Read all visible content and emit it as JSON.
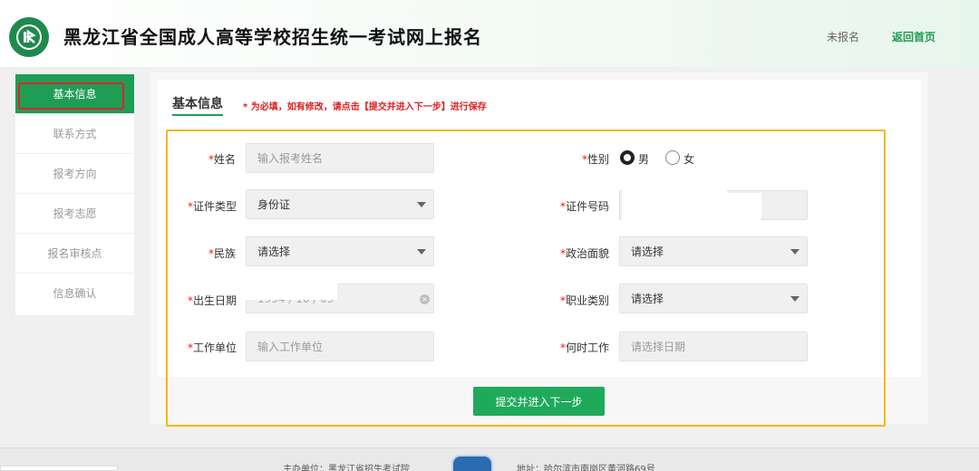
{
  "header": {
    "title": "黑龙江省全国成人高等学校招生统一考试网上报名",
    "status": "未报名",
    "home_link": "返回首页",
    "logo_icon": "book-person-icon",
    "brand_color": "#1e8a4c"
  },
  "sidebar": {
    "items": [
      {
        "label": "基本信息",
        "active": true
      },
      {
        "label": "联系方式",
        "active": false
      },
      {
        "label": "报考方向",
        "active": false
      },
      {
        "label": "报考志愿",
        "active": false
      },
      {
        "label": "报名审核点",
        "active": false
      },
      {
        "label": "信息确认",
        "active": false
      }
    ]
  },
  "section": {
    "title": "基本信息",
    "note": "* 为必填，如有修改，请点击【提交并进入下一步】进行保存"
  },
  "form": {
    "name": {
      "label": "姓名",
      "placeholder": "输入报考姓名"
    },
    "gender": {
      "label": "性别",
      "options": [
        "男",
        "女"
      ],
      "selected": "男"
    },
    "id_type": {
      "label": "证件类型",
      "value": "身份证"
    },
    "id_number": {
      "label": "证件号码"
    },
    "ethnicity": {
      "label": "民族",
      "value": "请选择"
    },
    "political": {
      "label": "政治面貌",
      "value": "请选择"
    },
    "birth_date": {
      "label": "出生日期",
      "value": "1994 / 10 / 09"
    },
    "occupation": {
      "label": "职业类别",
      "value": "请选择"
    },
    "employer": {
      "label": "工作单位",
      "placeholder": "输入工作单位"
    },
    "work_since": {
      "label": "何时工作",
      "placeholder": "请选择日期"
    }
  },
  "submit_label": "提交并进入下一步",
  "footer": {
    "organizer": "主办单位：黑龙江省招生考试院",
    "address": "地址：哈尔滨市南岗区黄河路69号"
  },
  "colors": {
    "accent": "#1f9d55",
    "required": "#e02020",
    "highlight_frame": "#f2b720",
    "active_outline": "#d9262c"
  }
}
